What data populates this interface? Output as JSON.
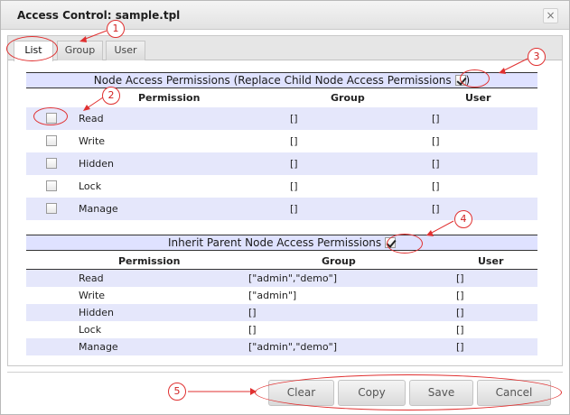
{
  "window": {
    "title": "Access Control: sample.tpl",
    "close_glyph": "×"
  },
  "tabs": [
    {
      "label": "List",
      "active": true
    },
    {
      "label": "Group",
      "active": false
    },
    {
      "label": "User",
      "active": false
    }
  ],
  "node_access": {
    "title": "Node Access Permissions (Replace Child Node Access Permissions",
    "title_suffix": ")",
    "replace_checked": true,
    "headers": {
      "permission": "Permission",
      "group": "Group",
      "user": "User"
    },
    "rows": [
      {
        "permission": "Read",
        "group": "[]",
        "user": "[]",
        "checked": false
      },
      {
        "permission": "Write",
        "group": "[]",
        "user": "[]",
        "checked": false
      },
      {
        "permission": "Hidden",
        "group": "[]",
        "user": "[]",
        "checked": false
      },
      {
        "permission": "Lock",
        "group": "[]",
        "user": "[]",
        "checked": false
      },
      {
        "permission": "Manage",
        "group": "[]",
        "user": "[]",
        "checked": false
      }
    ]
  },
  "inherit": {
    "title": "Inherit Parent Node Access Permissions",
    "inherit_checked": true,
    "headers": {
      "permission": "Permission",
      "group": "Group",
      "user": "User"
    },
    "rows": [
      {
        "permission": "Read",
        "group": "[\"admin\",\"demo\"]",
        "user": "[]"
      },
      {
        "permission": "Write",
        "group": "[\"admin\"]",
        "user": "[]"
      },
      {
        "permission": "Hidden",
        "group": "[]",
        "user": "[]"
      },
      {
        "permission": "Lock",
        "group": "[]",
        "user": "[]"
      },
      {
        "permission": "Manage",
        "group": "[\"admin\",\"demo\"]",
        "user": "[]"
      }
    ]
  },
  "buttons": {
    "clear": "Clear",
    "copy": "Copy",
    "save": "Save",
    "cancel": "Cancel"
  },
  "annotations": {
    "n1": "1",
    "n2": "2",
    "n3": "3",
    "n4": "4",
    "n5": "5",
    "color": "#e03030"
  }
}
